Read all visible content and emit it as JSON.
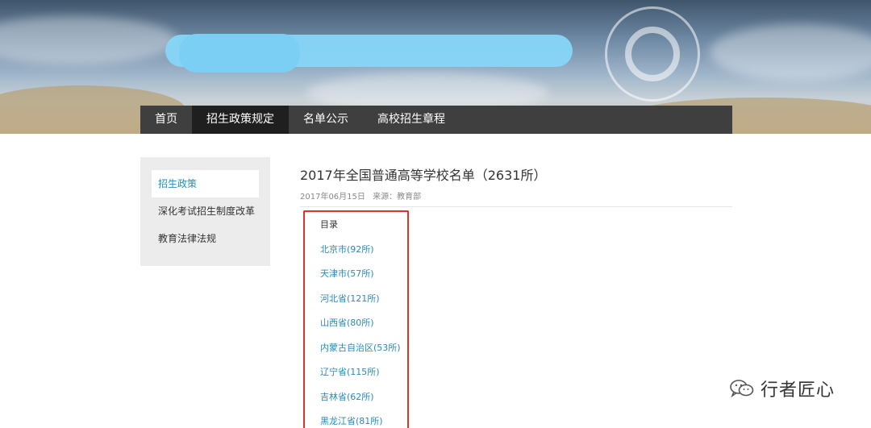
{
  "nav": {
    "items": [
      {
        "label": "首页",
        "active": false
      },
      {
        "label": "招生政策规定",
        "active": true
      },
      {
        "label": "名单公示",
        "active": false
      },
      {
        "label": "高校招生章程",
        "active": false
      }
    ]
  },
  "sidebar": {
    "items": [
      {
        "label": "招生政策",
        "active": true
      },
      {
        "label": "深化考试招生制度改革",
        "active": false
      },
      {
        "label": "教育法律法规",
        "active": false
      }
    ]
  },
  "article": {
    "title": "2017年全国普通高等学校名单（2631所）",
    "date": "2017年06月15日",
    "source": "来源：教育部"
  },
  "toc": {
    "heading": "目录",
    "links": [
      "北京市(92所)",
      "天津市(57所)",
      "河北省(121所)",
      "山西省(80所)",
      "内蒙古自治区(53所)",
      "辽宁省(115所)",
      "吉林省(62所)",
      "黑龙江省(81所)"
    ]
  },
  "watermark": {
    "text": "行者匠心",
    "icon": "wechat-icon"
  },
  "colors": {
    "nav_bg": "#3f3f3f",
    "nav_active_bg": "#1f1f1f",
    "link": "#2a8ab8",
    "highlight_border": "#d9362b",
    "sidebar_bg": "#ececec"
  }
}
